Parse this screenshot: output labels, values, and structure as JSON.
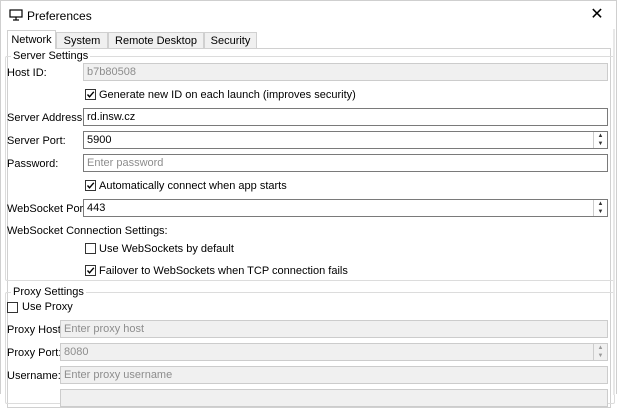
{
  "window": {
    "title": "Preferences",
    "icon": "monitor-icon",
    "close_symbol": "✕"
  },
  "tabs": [
    {
      "label": "Network",
      "active": true
    },
    {
      "label": "System",
      "active": false
    },
    {
      "label": "Remote Desktop",
      "active": false
    },
    {
      "label": "Security",
      "active": false
    }
  ],
  "server_settings": {
    "group_title": "Server Settings",
    "host_id_label": "Host ID:",
    "host_id_value": "b7b80508",
    "generate_new_id_label": "Generate new ID on each launch (improves security)",
    "generate_new_id_checked": true,
    "server_address_label": "Server Address:",
    "server_address_value": "rd.insw.cz",
    "server_port_label": "Server Port:",
    "server_port_value": "5900",
    "password_label": "Password:",
    "password_placeholder": "Enter password",
    "auto_connect_label": "Automatically connect when app starts",
    "auto_connect_checked": true,
    "websocket_port_label": "WebSocket Port:",
    "websocket_port_value": "443",
    "websocket_conn_label": "WebSocket Connection Settings:",
    "use_websockets_label": "Use WebSockets by default",
    "use_websockets_checked": false,
    "failover_label": "Failover to WebSockets when TCP connection fails",
    "failover_checked": true
  },
  "proxy_settings": {
    "group_title": "Proxy Settings",
    "use_proxy_label": "Use Proxy",
    "use_proxy_checked": false,
    "proxy_host_label": "Proxy Host:",
    "proxy_host_placeholder": "Enter proxy host",
    "proxy_port_label": "Proxy Port:",
    "proxy_port_value": "8080",
    "username_label": "Username:",
    "username_placeholder": "Enter proxy username"
  },
  "colors": {
    "border": "#7a7a7a",
    "disabled_bg": "#f0f0f0",
    "placeholder": "#8d8d8d"
  }
}
